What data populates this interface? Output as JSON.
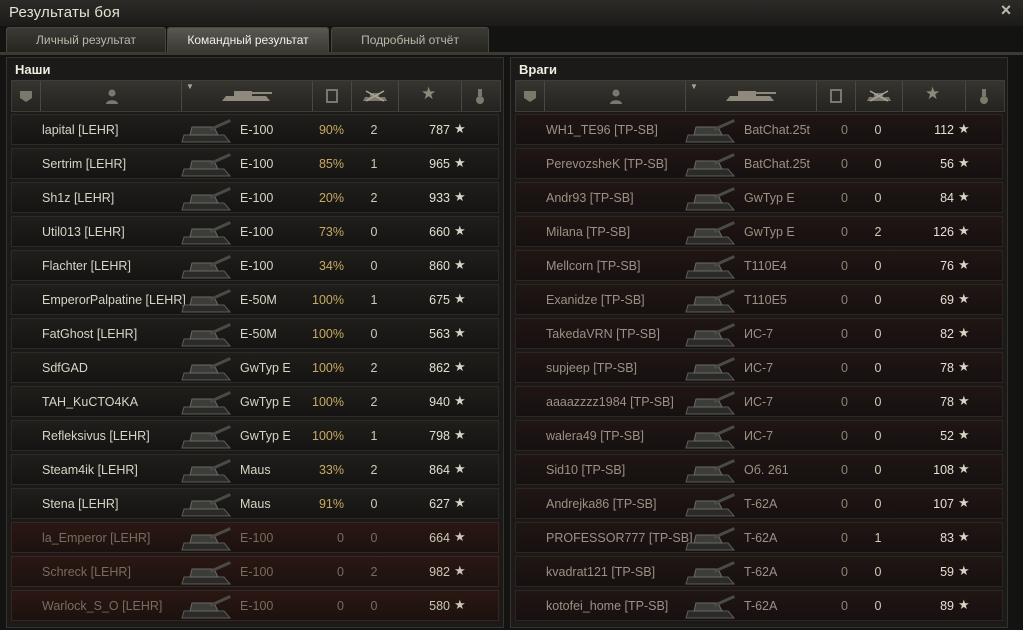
{
  "window": {
    "title": "Результаты боя",
    "close_icon": "×"
  },
  "tabs": [
    {
      "label": "Личный результат"
    },
    {
      "label": "Командный результат",
      "active": true
    },
    {
      "label": "Подробный отчёт"
    }
  ],
  "icons": {
    "rank": "▼",
    "player": "●",
    "vehicle": "tank",
    "damage": "▮",
    "kills": "✖",
    "xp": "★",
    "medal": "♦"
  },
  "allies": {
    "title": "Наши",
    "rows": [
      {
        "name": "lapital [LEHR]",
        "vehicle": "E-100",
        "damage": "90%",
        "kills": "2",
        "xp": "787",
        "dead": false
      },
      {
        "name": "Sertrim [LEHR]",
        "vehicle": "E-100",
        "damage": "85%",
        "kills": "1",
        "xp": "965",
        "dead": false
      },
      {
        "name": "Sh1z [LEHR]",
        "vehicle": "E-100",
        "damage": "20%",
        "kills": "2",
        "xp": "933",
        "dead": false
      },
      {
        "name": "Util013 [LEHR]",
        "vehicle": "E-100",
        "damage": "73%",
        "kills": "0",
        "xp": "660",
        "dead": false
      },
      {
        "name": "Flachter [LEHR]",
        "vehicle": "E-100",
        "damage": "34%",
        "kills": "0",
        "xp": "860",
        "dead": false
      },
      {
        "name": "EmperorPalpatine [LEHR]",
        "vehicle": "E-50M",
        "damage": "100%",
        "kills": "1",
        "xp": "675",
        "dead": false
      },
      {
        "name": "FatGhost [LEHR]",
        "vehicle": "E-50M",
        "damage": "100%",
        "kills": "0",
        "xp": "563",
        "dead": false
      },
      {
        "name": "SdfGAD",
        "vehicle": "GwTyp E",
        "damage": "100%",
        "kills": "2",
        "xp": "862",
        "dead": false
      },
      {
        "name": "TAH_KuCTO4KA",
        "vehicle": "GwTyp E",
        "damage": "100%",
        "kills": "2",
        "xp": "940",
        "dead": false
      },
      {
        "name": "Refleksivus [LEHR]",
        "vehicle": "GwTyp E",
        "damage": "100%",
        "kills": "1",
        "xp": "798",
        "dead": false
      },
      {
        "name": "Steam4ik [LEHR]",
        "vehicle": "Maus",
        "damage": "33%",
        "kills": "2",
        "xp": "864",
        "dead": false
      },
      {
        "name": "Stena [LEHR]",
        "vehicle": "Maus",
        "damage": "91%",
        "kills": "0",
        "xp": "627",
        "dead": false
      },
      {
        "name": "la_Emperor [LEHR]",
        "vehicle": "E-100",
        "damage": "0",
        "kills": "0",
        "xp": "664",
        "dead": true
      },
      {
        "name": "Schreck [LEHR]",
        "vehicle": "E-100",
        "damage": "0",
        "kills": "2",
        "xp": "982",
        "dead": true
      },
      {
        "name": "Warlock_S_O [LEHR]",
        "vehicle": "E-100",
        "damage": "0",
        "kills": "0",
        "xp": "580",
        "dead": true
      }
    ]
  },
  "enemies": {
    "title": "Враги",
    "rows": [
      {
        "name": "WH1_TE96 [TP-SB]",
        "vehicle": "BatChat.25t",
        "damage": "0",
        "kills": "0",
        "xp": "112"
      },
      {
        "name": "PerevozsheK [TP-SB]",
        "vehicle": "BatChat.25t",
        "damage": "0",
        "kills": "0",
        "xp": "56"
      },
      {
        "name": "Andr93 [TP-SB]",
        "vehicle": "GwTyp E",
        "damage": "0",
        "kills": "0",
        "xp": "84"
      },
      {
        "name": "Milana [TP-SB]",
        "vehicle": "GwTyp E",
        "damage": "0",
        "kills": "2",
        "xp": "126"
      },
      {
        "name": "Mellcorn [TP-SB]",
        "vehicle": "T110E4",
        "damage": "0",
        "kills": "0",
        "xp": "76"
      },
      {
        "name": "Exanidze [TP-SB]",
        "vehicle": "T110E5",
        "damage": "0",
        "kills": "0",
        "xp": "69"
      },
      {
        "name": "TakedaVRN [TP-SB]",
        "vehicle": "ИС-7",
        "damage": "0",
        "kills": "0",
        "xp": "82"
      },
      {
        "name": "supjeep [TP-SB]",
        "vehicle": "ИС-7",
        "damage": "0",
        "kills": "0",
        "xp": "78"
      },
      {
        "name": "aaaazzzz1984 [TP-SB]",
        "vehicle": "ИС-7",
        "damage": "0",
        "kills": "0",
        "xp": "78"
      },
      {
        "name": "walera49 [TP-SB]",
        "vehicle": "ИС-7",
        "damage": "0",
        "kills": "0",
        "xp": "52"
      },
      {
        "name": "Sid10 [TP-SB]",
        "vehicle": "Об. 261",
        "damage": "0",
        "kills": "0",
        "xp": "108"
      },
      {
        "name": "Andrejka86 [TP-SB]",
        "vehicle": "T-62A",
        "damage": "0",
        "kills": "0",
        "xp": "107"
      },
      {
        "name": "PROFESSOR777 [TP-SB]",
        "vehicle": "T-62A",
        "damage": "0",
        "kills": "1",
        "xp": "83"
      },
      {
        "name": "kvadrat121 [TP-SB]",
        "vehicle": "T-62A",
        "damage": "0",
        "kills": "0",
        "xp": "59"
      },
      {
        "name": "kotofei_home [TP-SB]",
        "vehicle": "T-62A",
        "damage": "0",
        "kills": "0",
        "xp": "89"
      }
    ]
  }
}
